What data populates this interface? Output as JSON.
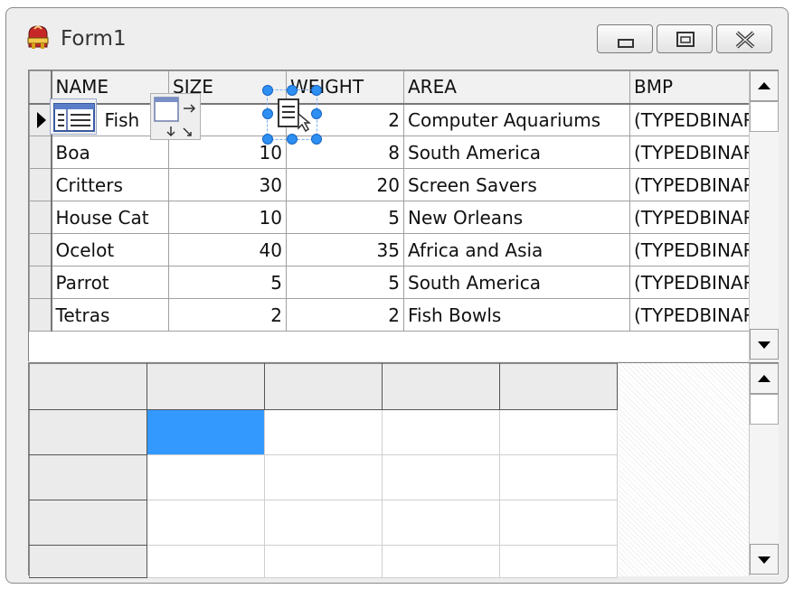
{
  "window": {
    "title": "Form1",
    "app_icon": "delphi-helmet-icon",
    "buttons": [
      "minimize-icon",
      "maximize-icon",
      "close-icon"
    ]
  },
  "db_grid": {
    "columns": [
      "NAME",
      "SIZE",
      "WEIGHT",
      "AREA",
      "BMP"
    ],
    "rows": [
      {
        "name": "Fish",
        "size": "",
        "weight": "2",
        "area": "Computer Aquariums",
        "bmp": "(TYPEDBINARY)"
      },
      {
        "name": "Boa",
        "size": "10",
        "weight": "8",
        "area": "South America",
        "bmp": "(TYPEDBINARY)"
      },
      {
        "name": "Critters",
        "size": "30",
        "weight": "20",
        "area": "Screen Savers",
        "bmp": "(TYPEDBINARY)"
      },
      {
        "name": "House Cat",
        "size": "10",
        "weight": "5",
        "area": "New Orleans",
        "bmp": "(TYPEDBINARY)"
      },
      {
        "name": "Ocelot",
        "size": "40",
        "weight": "35",
        "area": "Africa and Asia",
        "bmp": "(TYPEDBINARY)"
      },
      {
        "name": "Parrot",
        "size": "5",
        "weight": "5",
        "area": "South America",
        "bmp": "(TYPEDBINARY)"
      },
      {
        "name": "Tetras",
        "size": "2",
        "weight": "2",
        "area": "Fish Bowls",
        "bmp": "(TYPEDBINARY)"
      }
    ],
    "current_row_marker": "row-indicator-arrow-icon"
  },
  "components": {
    "icons": [
      "table-component-icon",
      "layout-component-icon",
      "datasource-component-icon"
    ]
  },
  "colors": {
    "selection": "#3399ff",
    "handle": "#2e8ff2",
    "window_bg": "#eeeeee"
  }
}
